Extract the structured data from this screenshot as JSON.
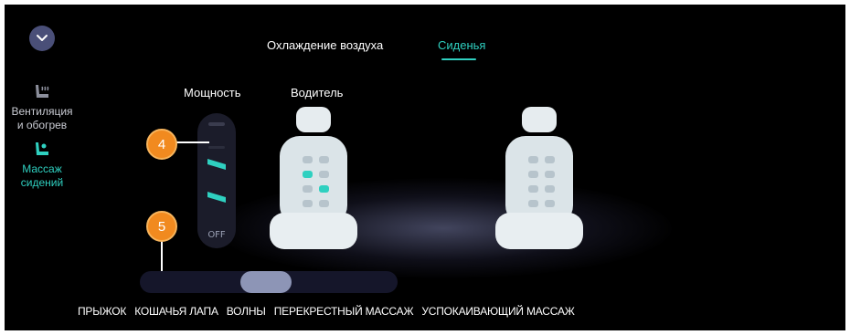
{
  "colors": {
    "accent": "#2fd0c0",
    "callout": "#f18a1f",
    "background": "#000000"
  },
  "header": {
    "collapse_icon": "chevron-down-icon",
    "tabs": [
      {
        "label": "Охлаждение воздуха",
        "active": false
      },
      {
        "label": "Сиденья",
        "active": true
      }
    ]
  },
  "sidebar": {
    "items": [
      {
        "label_line1": "Вентиляция",
        "label_line2": "и обогрев",
        "icon": "seat-heat-icon",
        "active": false
      },
      {
        "label_line1": "Массаж",
        "label_line2": "сидений",
        "icon": "seat-massage-icon",
        "active": true
      }
    ]
  },
  "power": {
    "title": "Мощность",
    "off_label": "OFF",
    "level_count": 3
  },
  "driver": {
    "title": "Водитель"
  },
  "callouts": [
    "4",
    "5"
  ],
  "massage_modes": [
    "ПРЫЖОК",
    "КОШАЧЬЯ ЛАПА",
    "ВОЛНЫ",
    "ПЕРЕКРЕСТНЫЙ МАССАЖ",
    "УСПОКАИВАЮЩИЙ МАССАЖ"
  ]
}
